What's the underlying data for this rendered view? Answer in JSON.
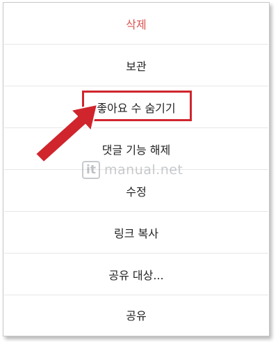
{
  "menu": {
    "items": [
      {
        "label": "삭제",
        "danger": true
      },
      {
        "label": "보관"
      },
      {
        "label": "좋아요 수 숨기기"
      },
      {
        "label": "댓글 기능 해제"
      },
      {
        "label": "수정"
      },
      {
        "label": "링크 복사"
      },
      {
        "label": "공유 대상..."
      },
      {
        "label": "공유"
      }
    ]
  },
  "watermark": {
    "logo": "it",
    "text": "manual.net"
  },
  "annotation": {
    "arrow_icon": "red-arrow-icon",
    "color": "#d0252d"
  }
}
